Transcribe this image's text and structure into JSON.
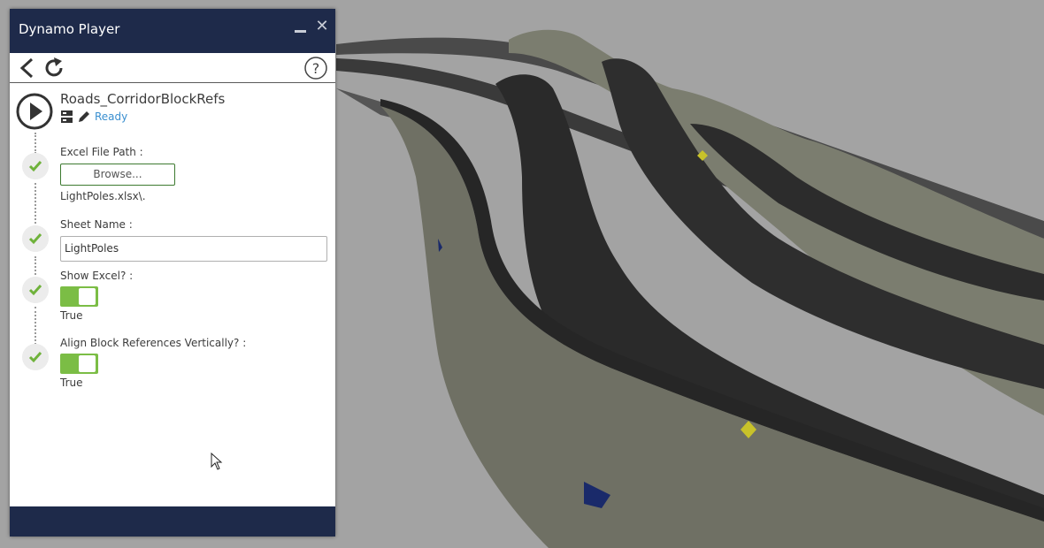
{
  "window": {
    "title": "Dynamo Player",
    "minimize_icon": "minimize-icon",
    "close_icon": "close-icon",
    "close_glyph": "✕"
  },
  "toolbar": {
    "back_icon": "back-arrow-icon",
    "refresh_icon": "refresh-icon",
    "help_icon": "help-icon"
  },
  "script": {
    "name": "Roads_CorridorBlockRefs",
    "status": "Ready",
    "icons": [
      "server-icon",
      "edit-pencil-icon"
    ]
  },
  "inputs": {
    "excel_file_path": {
      "label": "Excel File Path :",
      "button_label": "Browse...",
      "value": "LightPoles.xlsx\\."
    },
    "sheet_name": {
      "label": "Sheet Name :",
      "value": "LightPoles"
    },
    "show_excel": {
      "label": "Show Excel? :",
      "value": "True"
    },
    "align_block_references": {
      "label": "Align Block References Vertically? :",
      "value": "True"
    }
  },
  "colors": {
    "title_bar": "#1e2a4a",
    "accent_green": "#7bbd45",
    "status_blue": "#3a8fd0",
    "check_green": "#6fb23b"
  }
}
